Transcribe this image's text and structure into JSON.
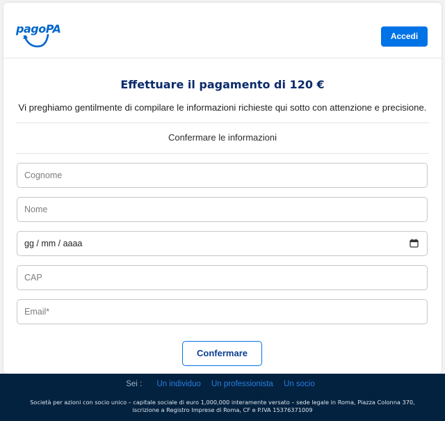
{
  "header": {
    "logo_text": "pagoPA",
    "login_label": "Accedi"
  },
  "main": {
    "title": "Effettuare il pagamento di 120 €",
    "subtitle": "Vi preghiamo gentilmente di compilare le informazioni richieste qui sotto con attenzione e precisione.",
    "section_label": "Confermare le informazioni",
    "fields": {
      "surname_placeholder": "Cognome",
      "name_placeholder": "Nome",
      "date_value": "gg / mm / aaaa",
      "cap_placeholder": "CAP",
      "email_placeholder": "Email*"
    },
    "confirm_label": "Confermare"
  },
  "footer": {
    "sei_label": "Sei :",
    "links": [
      "Un individuo",
      "Un professionista",
      "Un socio"
    ],
    "legal_line1": "Società per azioni con socio unico – capitale sociale di euro 1,000,000 interamente versato – sede legale in Roma, Piazza Colonna 370,",
    "legal_line2": "iscrizione a Registro Imprese di Roma, CF e P.IVA 15376371009"
  },
  "colors": {
    "accent": "#0073e6",
    "title": "#0b2a6b",
    "footer_bg": "#03223f"
  },
  "icons": {
    "logo": "pagopa-logo-icon",
    "calendar": "calendar-icon"
  }
}
